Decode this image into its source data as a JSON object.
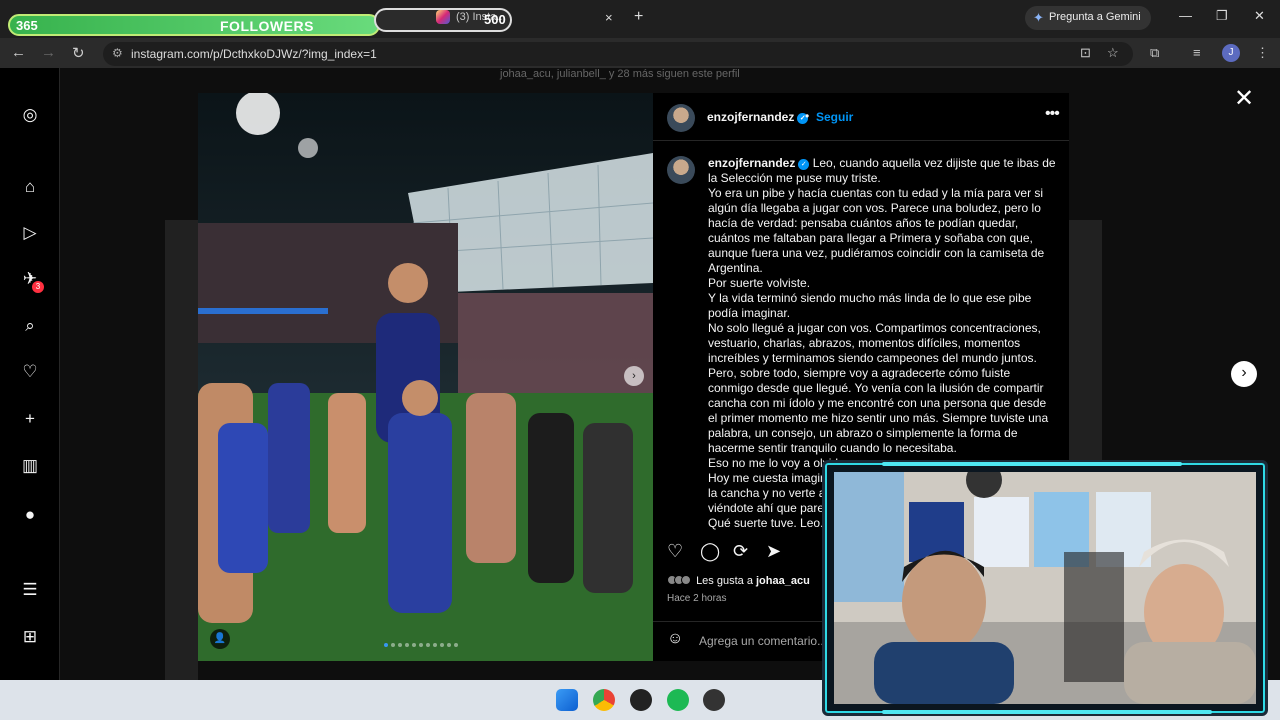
{
  "browser": {
    "tab1_followers_count": "365",
    "tab1_followers_label": "FOLLOWERS",
    "goal_value": "500",
    "tab2_title": "(3) Insta...",
    "new_tab_label": "+",
    "gemini_label": "Pregunta a Gemini",
    "url": "instagram.com/p/DcthxkoDJWz/?img_index=1",
    "profile_initial": "J",
    "close_tab_glyph": "×"
  },
  "instagram": {
    "followers_hint": "johaa_acu, julianbell_ y 28 más siguen este perfil",
    "notification_count": "3",
    "post": {
      "username": "enzojfernandez",
      "follow_label": "Seguir",
      "dot": "•",
      "caption_user": "enzojfernandez",
      "caption": " Leo, cuando aquella vez dijiste que te ibas de la Selección me puse muy triste.\nYo era un pibe y hacía cuentas con tu edad y la mía para ver si algún día llegaba a jugar con vos. Parece una boludez, pero lo hacía de verdad: pensaba cuántos años te podían quedar, cuántos me faltaban para llegar a Primera y soñaba con que, aunque fuera una vez, pudiéramos coincidir con la camiseta de Argentina.\nPor suerte volviste.\nY la vida terminó siendo mucho más linda de lo que ese pibe podía imaginar.\nNo solo llegué a jugar con vos. Compartimos concentraciones, vestuario, charlas, abrazos, momentos difíciles, momentos increíbles y terminamos siendo campeones del mundo juntos.\nPero, sobre todo, siempre voy a agradecerte cómo fuiste conmigo desde que llegué. Yo venía con la ilusión de compartir cancha con mi ídolo y me encontré con una persona que desde el primer momento me hizo sentir uno más. Siempre tuviste una palabra, un consejo, un abrazo o simplemente la forma de hacerme sentir tranquilo cuando lo necesitaba.\nEso no me lo voy a olvid\nHoy me cuesta imagin\nla cancha y no verte a\nviéndote ahí que pare\nQué suerte tuve. Leo.",
      "likes_prefix": "Les gusta a ",
      "likes_user": "johaa_acu",
      "time_ago": "Hace 2 horas",
      "comment_placeholder": "Agrega un comentario..."
    }
  }
}
